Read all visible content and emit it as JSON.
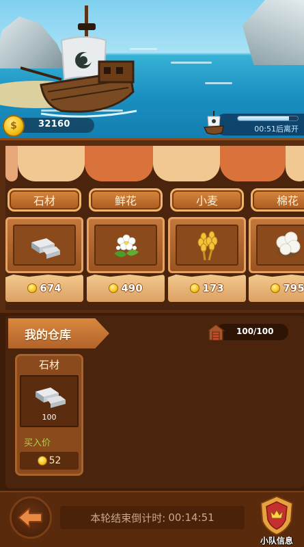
{
  "hud": {
    "coins": "32160",
    "departure_text": "00:51后离开",
    "departure_progress": 0.85
  },
  "market": {
    "stalls": [
      {
        "name": "石材",
        "price": "674",
        "icon": "stone-icon"
      },
      {
        "name": "鲜花",
        "price": "490",
        "icon": "flower-icon"
      },
      {
        "name": "小麦",
        "price": "173",
        "icon": "wheat-icon"
      },
      {
        "name": "棉花",
        "price": "795",
        "icon": "cotton-icon"
      }
    ]
  },
  "warehouse": {
    "title": "我的仓库",
    "capacity": "100/100",
    "items": [
      {
        "name": "石材",
        "quantity": "100",
        "buy_label": "买入价",
        "buy_price": "52",
        "icon": "stone-icon"
      }
    ]
  },
  "footer": {
    "countdown_label": "本轮结束倒计时:",
    "countdown_value": "00:14:51",
    "team_label": "小队信息"
  },
  "colors": {
    "price_text": "#ffffff",
    "buy_label": "#a6d83c",
    "wood_dark": "#4a240c",
    "wood_mid": "#8a4a1c"
  }
}
